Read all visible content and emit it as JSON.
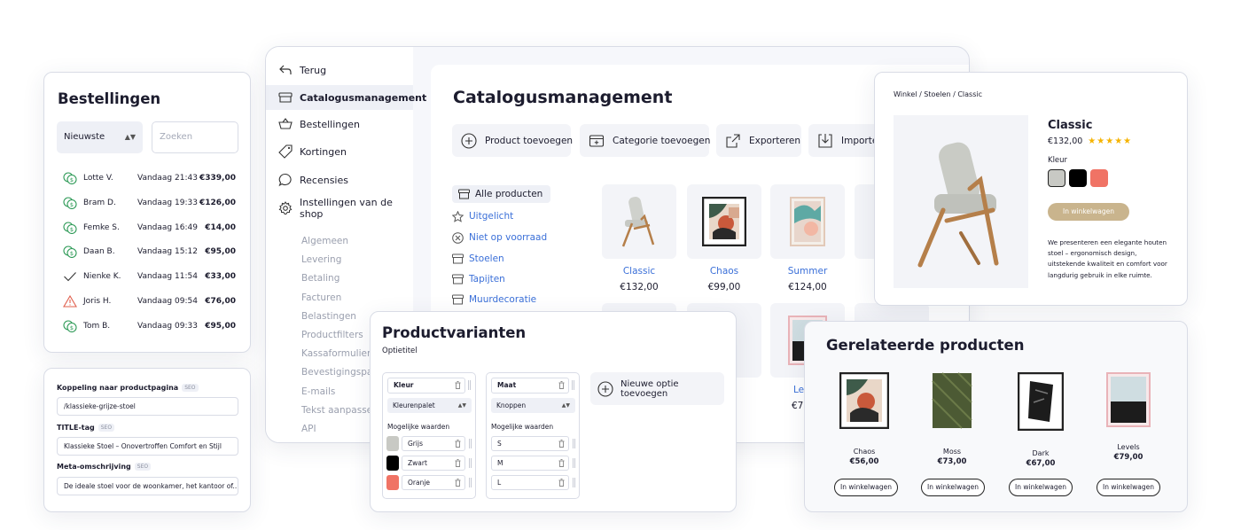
{
  "main": {
    "back_label": "Terug",
    "nav": [
      {
        "label": "Catalogusmanagement",
        "icon": "box-icon"
      },
      {
        "label": "Bestellingen",
        "icon": "basket-icon"
      },
      {
        "label": "Kortingen",
        "icon": "tag-icon"
      },
      {
        "label": "Recensies",
        "icon": "chat-bubble-icon"
      },
      {
        "label": "Instellingen van de shop",
        "icon": "gear-icon"
      }
    ],
    "settings_sub": [
      "Algemeen",
      "Levering",
      "Betaling",
      "Facturen",
      "Belastingen",
      "Productfilters",
      "Kassaformulier",
      "Bevestigingspag",
      "E-mails",
      "Tekst aanpassen",
      "API"
    ],
    "title": "Catalogusmanagement",
    "toolbar": [
      "Product toevoegen",
      "Categorie toevoegen",
      "Exporteren",
      "Importer"
    ],
    "categories": [
      "Alle producten",
      "Uitgelicht",
      "Niet op voorraad",
      "Stoelen",
      "Tapijten",
      "Muurdecoratie"
    ],
    "products": [
      {
        "name": "Classic",
        "price": "€132,00"
      },
      {
        "name": "Chaos",
        "price": "€99,00"
      },
      {
        "name": "Summer",
        "price": "€124,00"
      }
    ],
    "row2_partial": [
      {
        "name": "n",
        "price": "0"
      },
      {
        "name": "Le",
        "price": "€7"
      }
    ]
  },
  "orders": {
    "title": "Bestellingen",
    "sort_value": "Nieuwste",
    "search_placeholder": "Zoeken",
    "rows": [
      {
        "name": "Lotte V.",
        "time": "Vandaag 21:43",
        "amount": "€339,00",
        "status": "paid-icon"
      },
      {
        "name": "Bram D.",
        "time": "Vandaag 19:33",
        "amount": "€126,00",
        "status": "paid-icon"
      },
      {
        "name": "Femke S.",
        "time": "Vandaag 16:49",
        "amount": "€14,00",
        "status": "paid-icon"
      },
      {
        "name": "Daan B.",
        "time": "Vandaag 15:12",
        "amount": "€95,00",
        "status": "paid-icon"
      },
      {
        "name": "Nienke K.",
        "time": "Vandaag 11:54",
        "amount": "€33,00",
        "status": "checkmark-icon"
      },
      {
        "name": "Joris H.",
        "time": "Vandaag 09:54",
        "amount": "€76,00",
        "status": "warning-icon"
      },
      {
        "name": "Tom B.",
        "time": "Vandaag 09:33",
        "amount": "€95,00",
        "status": "paid-icon"
      }
    ]
  },
  "seo": {
    "tag": "SEO",
    "link_label": "Koppeling naar productpagina",
    "link_value": "/klassieke-grijze-stoel",
    "title_label": "TITLE-tag",
    "title_value": "Klassieke Stoel – Onovertroffen Comfort en Stijl",
    "meta_label": "Meta-omschrijving",
    "meta_value": "De ideale stoel voor de woonkamer, het kantoor of..."
  },
  "detail": {
    "breadcrumb": "Winkel  / Stoelen / Classic",
    "name": "Classic",
    "price": "€132,00",
    "stars": "★★★★★",
    "rating": 5,
    "color_label": "Kleur",
    "colors": [
      "#c8c9c4",
      "#000000",
      "#f07365"
    ],
    "add_label": "In winkelwagen",
    "description": "We presenteren een elegante houten stoel – ergonomisch design, uitstekende kwaliteit en comfort voor langdurig gebruik in elke ruimte."
  },
  "related": {
    "title": "Gerelateerde producten",
    "items": [
      {
        "name": "Chaos",
        "price": "€56,00"
      },
      {
        "name": "Moss",
        "price": "€73,00"
      },
      {
        "name": "Dark",
        "price": "€67,00"
      },
      {
        "name": "Levels",
        "price": "€79,00"
      }
    ],
    "button_label": "In winkelwagen"
  },
  "variants": {
    "title": "Productvarianten",
    "subtitle": "Optietitel",
    "options": [
      {
        "name": "Kleur",
        "type": "Kleurenpalet",
        "values_label": "Mogelijke waarden",
        "values": [
          "Grijs",
          "Zwart",
          "Oranje"
        ],
        "swatches": [
          "#c8c9c4",
          "#000000",
          "#f07365"
        ]
      },
      {
        "name": "Maat",
        "type": "Knoppen",
        "values_label": "Mogelijke waarden",
        "values": [
          "S",
          "M",
          "L"
        ]
      }
    ],
    "new_option_label": "Nieuwe optie toevoegen"
  }
}
